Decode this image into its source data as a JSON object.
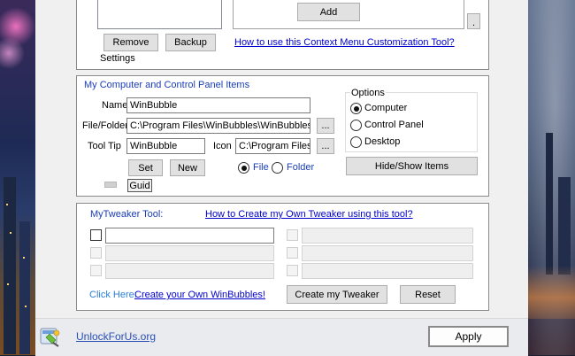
{
  "top_section": {
    "add_label": "Add",
    "more_label": ".",
    "remove_label": "Remove",
    "backup_label": "Backup",
    "settings_label": "Settings",
    "help_link": "How to use this Context Menu Customization Tool?"
  },
  "computer_panel": {
    "title": "My Computer and Control Panel Items",
    "name_label": "Name",
    "name_value": "WinBubble",
    "file_folder_label": "File/Folder",
    "file_folder_value": "C:\\Program Files\\WinBubbles\\WinBubbles.exe",
    "browse_label": "...",
    "tooltip_label": "Tool Tip",
    "tooltip_value": "WinBubble",
    "icon_label": "Icon",
    "icon_value": "C:\\Program Files\\",
    "icon_browse_label": "...",
    "set_label": "Set",
    "new_label": "New",
    "file_radio_label": "File",
    "folder_radio_label": "Folder",
    "guid_label": "Guid",
    "options": {
      "title": "Options",
      "items": [
        "Computer",
        "Control Panel",
        "Desktop"
      ],
      "selected": "Computer"
    },
    "hide_show_label": "Hide/Show Items"
  },
  "tweaker_panel": {
    "title": "MyTweaker Tool:",
    "help_link": "How to Create my Own Tweaker using this tool?",
    "click_here_label": "Click Here:",
    "create_link": "Create your Own WinBubbles!",
    "create_button": "Create my Tweaker",
    "reset_button": "Reset"
  },
  "footer": {
    "site_link": "UnlockForUs.org",
    "apply_label": "Apply"
  }
}
